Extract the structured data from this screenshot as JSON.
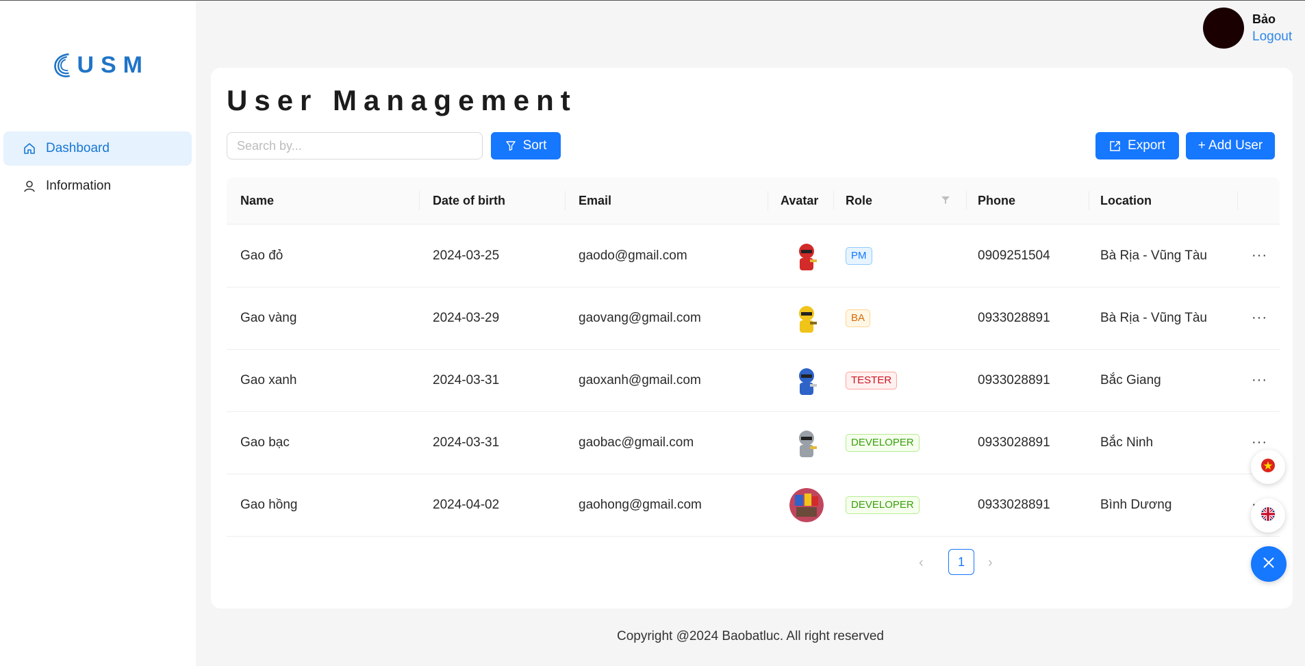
{
  "brand": {
    "logo_text": "USM"
  },
  "sidebar": {
    "items": [
      {
        "label": "Dashboard",
        "icon": "home-icon",
        "active": true
      },
      {
        "label": "Information",
        "icon": "user-icon",
        "active": false
      }
    ]
  },
  "user": {
    "name": "Bảo",
    "logout_label": "Logout"
  },
  "main": {
    "title": "User Management",
    "search": {
      "placeholder": "Search by...",
      "value": ""
    },
    "sort_label": "Sort",
    "export_label": "Export",
    "add_user_label": "+ Add User"
  },
  "table": {
    "headers": {
      "name": "Name",
      "dob": "Date of birth",
      "email": "Email",
      "avatar": "Avatar",
      "role": "Role",
      "phone": "Phone",
      "location": "Location"
    },
    "rows": [
      {
        "name": "Gao đỏ",
        "dob": "2024-03-25",
        "email": "gaodo@gmail.com",
        "role": "PM",
        "role_color": "blue",
        "avatar_color": "#d32a2a",
        "phone": "0909251504",
        "location": "Bà Rịa - Vũng Tàu",
        "actions": "···"
      },
      {
        "name": "Gao vàng",
        "dob": "2024-03-29",
        "email": "gaovang@gmail.com",
        "role": "BA",
        "role_color": "orange",
        "avatar_color": "#f0c419",
        "phone": "0933028891",
        "location": "Bà Rịa - Vũng Tàu",
        "actions": "···"
      },
      {
        "name": "Gao xanh",
        "dob": "2024-03-31",
        "email": "gaoxanh@gmail.com",
        "role": "TESTER",
        "role_color": "red",
        "avatar_color": "#2e63c7",
        "phone": "0933028891",
        "location": "Bắc Giang",
        "actions": "···"
      },
      {
        "name": "Gao bạc",
        "dob": "2024-03-31",
        "email": "gaobac@gmail.com",
        "role": "DEVELOPER",
        "role_color": "green",
        "avatar_color": "#9aa0a8",
        "phone": "0933028891",
        "location": "Bắc Ninh",
        "actions": "···"
      },
      {
        "name": "Gao hồng",
        "dob": "2024-04-02",
        "email": "gaohong@gmail.com",
        "role": "DEVELOPER",
        "role_color": "green",
        "avatar_color": "#c0465e",
        "phone": "0933028891",
        "location": "Bình Dương",
        "actions": "···"
      }
    ]
  },
  "pagination": {
    "current_page": "1"
  },
  "footer": {
    "text": "Copyright @2024 Baobatluc. All right reserved"
  },
  "floating": {
    "icons": [
      "vietnam-flag-icon",
      "uk-flag-icon",
      "close-icon"
    ]
  }
}
